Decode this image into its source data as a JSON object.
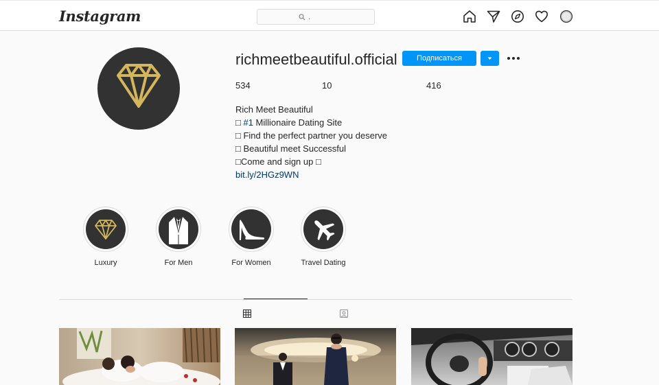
{
  "app": {
    "logo": "Instagram"
  },
  "search": {
    "placeholder": "."
  },
  "nav": {
    "icons": [
      "home-icon",
      "direct-icon",
      "explore-icon",
      "activity-icon",
      "profile-avatar"
    ]
  },
  "profile": {
    "username": "richmeetbeautiful.official",
    "follow_label": "Подписаться",
    "stats": {
      "posts": "534",
      "followers": "10",
      "following": "416"
    },
    "bio": {
      "name": "Rich Meet Beautiful",
      "line1_prefix": "□ ",
      "line1_hashtag": "#1",
      "line1_rest": " Millionaire Dating Site",
      "line2": "□ Find the perfect partner you deserve",
      "line3": "□ Beautiful meet Successful",
      "line4": "□Come and sign up □",
      "link": "bit.ly/2HGz9WN"
    }
  },
  "highlights": [
    {
      "label": "Luxury",
      "icon": "diamond-icon"
    },
    {
      "label": "For Men",
      "icon": "suit-icon"
    },
    {
      "label": "For Women",
      "icon": "high-heel-icon"
    },
    {
      "label": "Travel Dating",
      "icon": "airplane-icon"
    }
  ],
  "tabs": [
    {
      "icon": "grid-icon",
      "label": ""
    },
    {
      "icon": "tagged-icon",
      "label": ""
    }
  ],
  "colors": {
    "accent": "#0095f6",
    "gold": "#d4b65c",
    "dark": "#323232",
    "link": "#00376b"
  }
}
